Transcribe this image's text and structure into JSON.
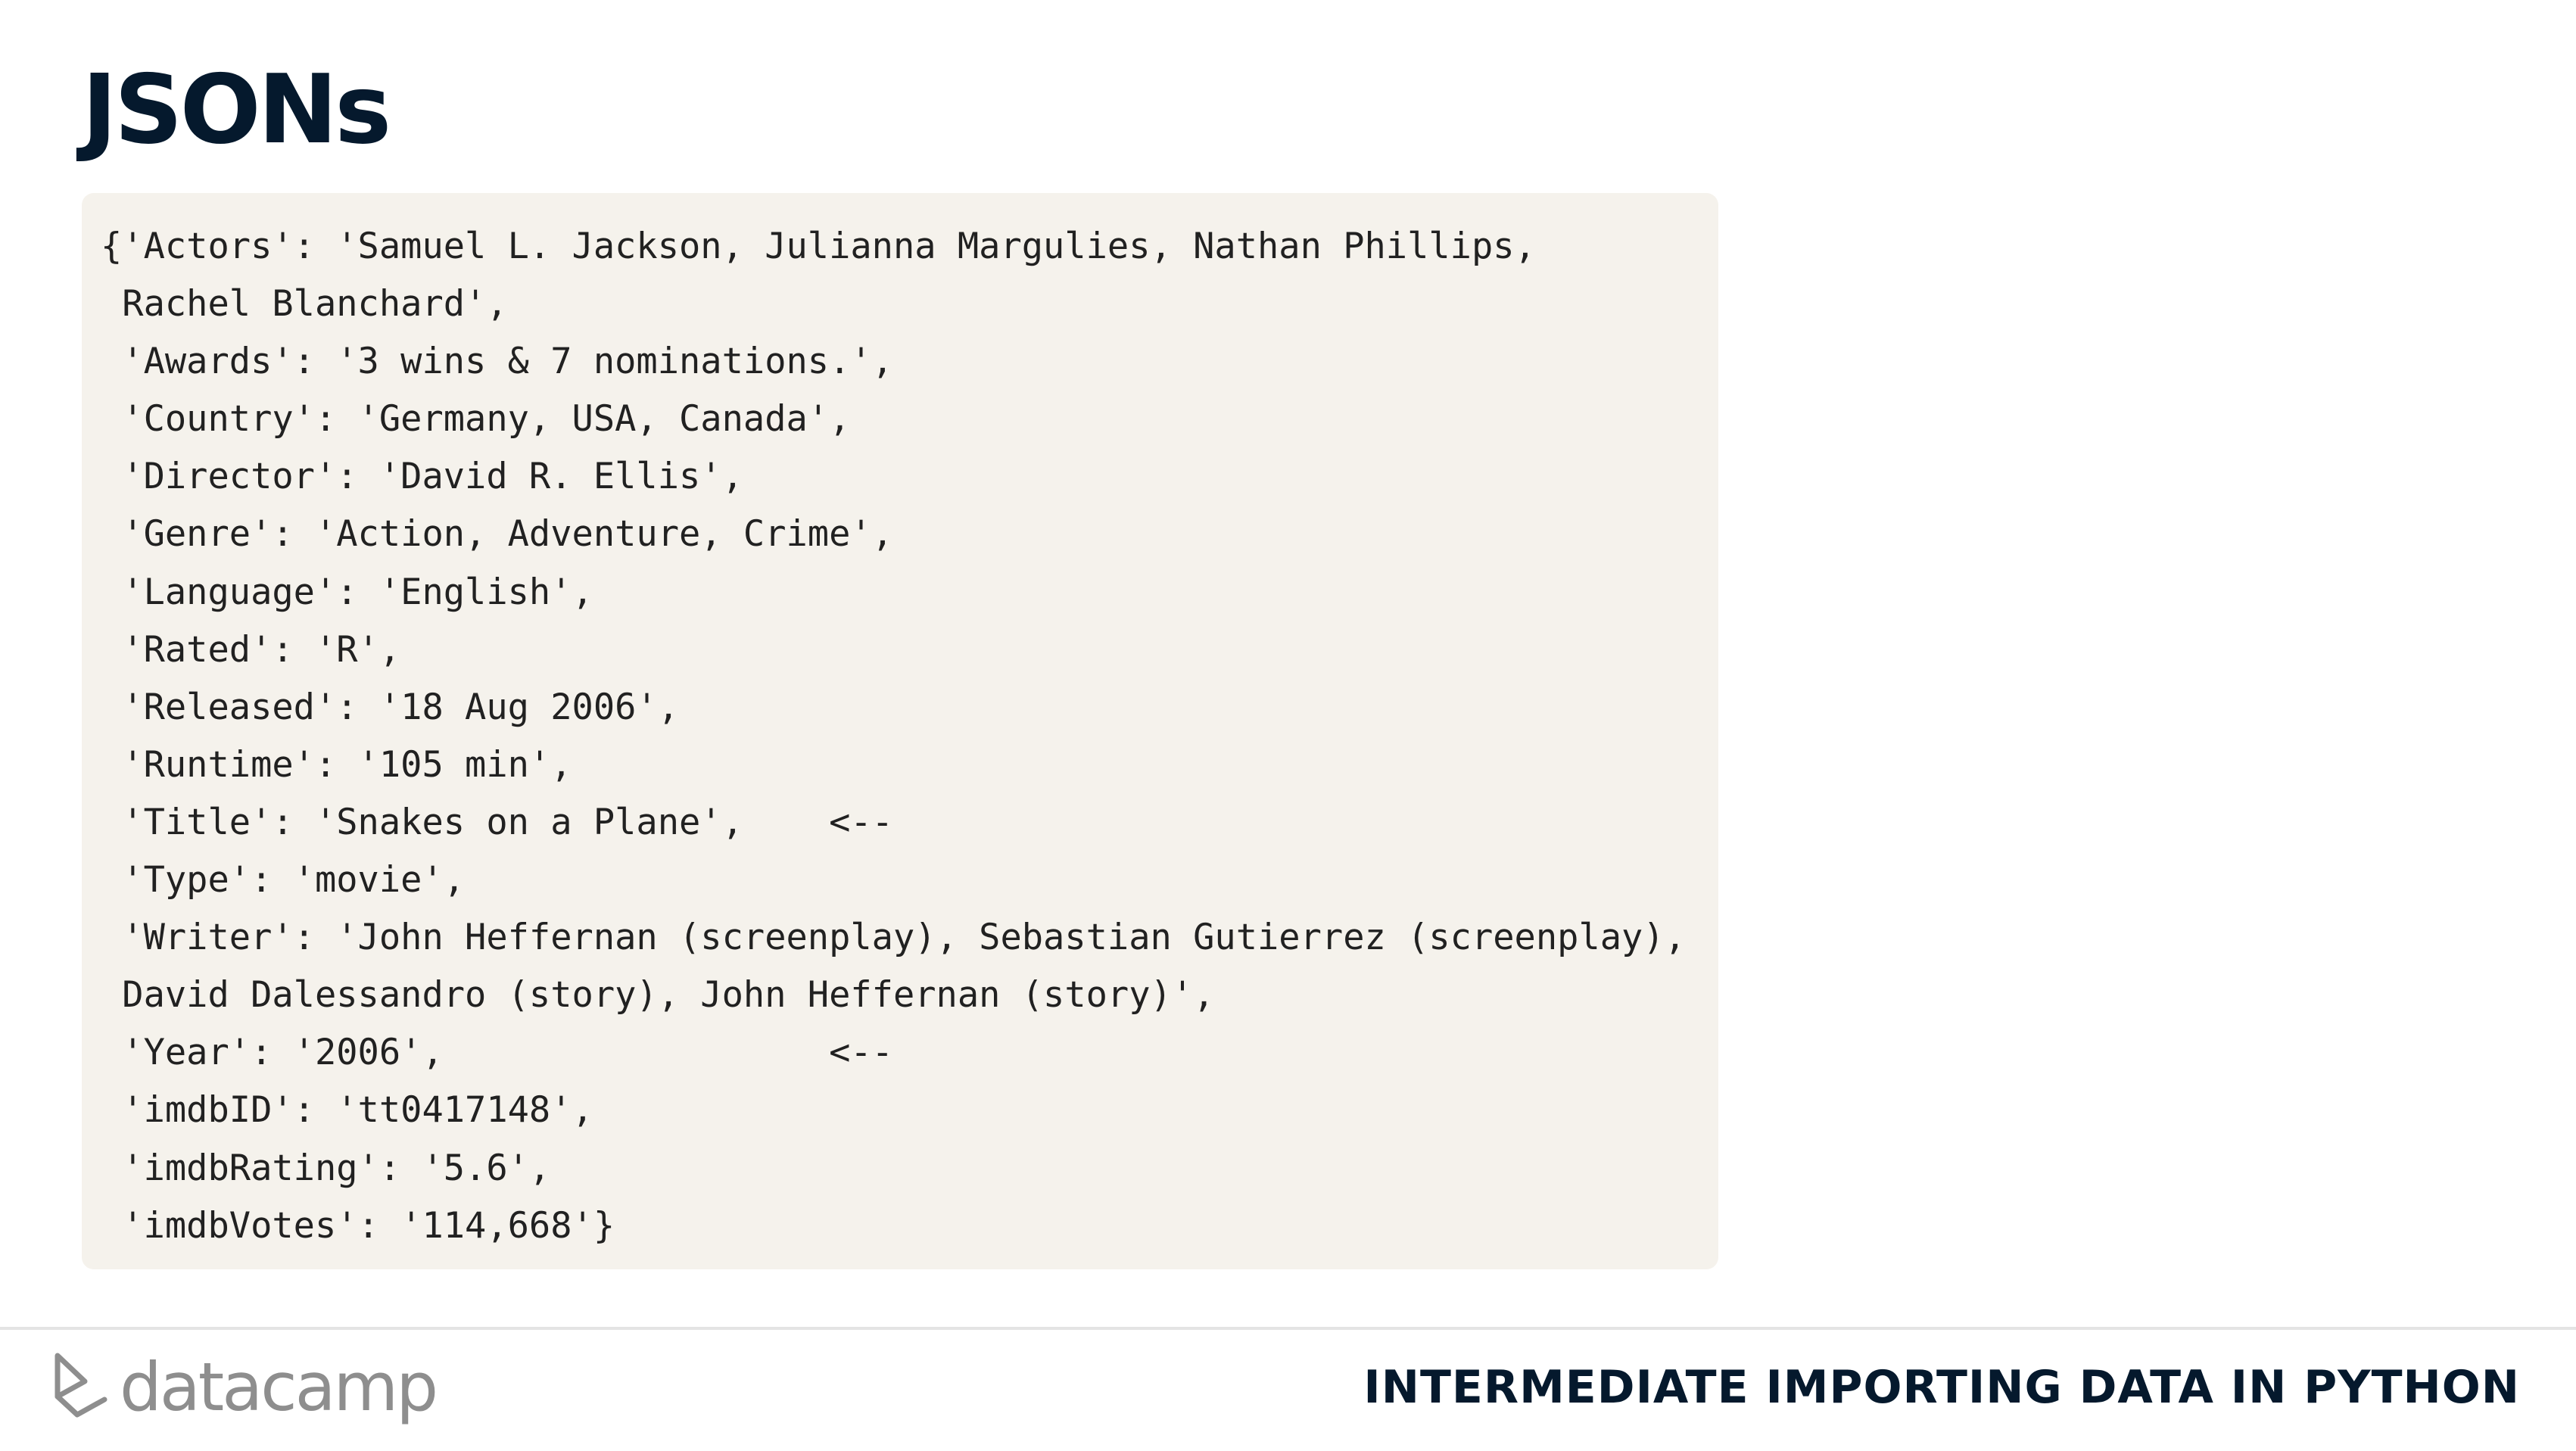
{
  "slide": {
    "title": "JSONs"
  },
  "code": {
    "lines": [
      "{'Actors': 'Samuel L. Jackson, Julianna Margulies, Nathan Phillips,",
      " Rachel Blanchard',",
      " 'Awards': '3 wins & 7 nominations.',",
      " 'Country': 'Germany, USA, Canada',",
      " 'Director': 'David R. Ellis',",
      " 'Genre': 'Action, Adventure, Crime',",
      " 'Language': 'English',",
      " 'Rated': 'R',",
      " 'Released': '18 Aug 2006',",
      " 'Runtime': '105 min',",
      " 'Title': 'Snakes on a Plane',    <--",
      " 'Type': 'movie',",
      " 'Writer': 'John Heffernan (screenplay), Sebastian Gutierrez (screenplay),",
      " David Dalessandro (story), John Heffernan (story)',",
      " 'Year': '2006',                  <--",
      " 'imdbID': 'tt0417148',",
      " 'imdbRating': '5.6',",
      " 'imdbVotes': '114,668'}"
    ]
  },
  "footer": {
    "logo_text": "datacamp",
    "course_title": "INTERMEDIATE IMPORTING DATA IN PYTHON"
  },
  "colors": {
    "title": "#05192d",
    "code_background": "#f5f2ec",
    "code_text": "#212121",
    "logo": "#8e8e8e"
  },
  "icons": {
    "logo_icon": "datacamp-logo-icon"
  }
}
